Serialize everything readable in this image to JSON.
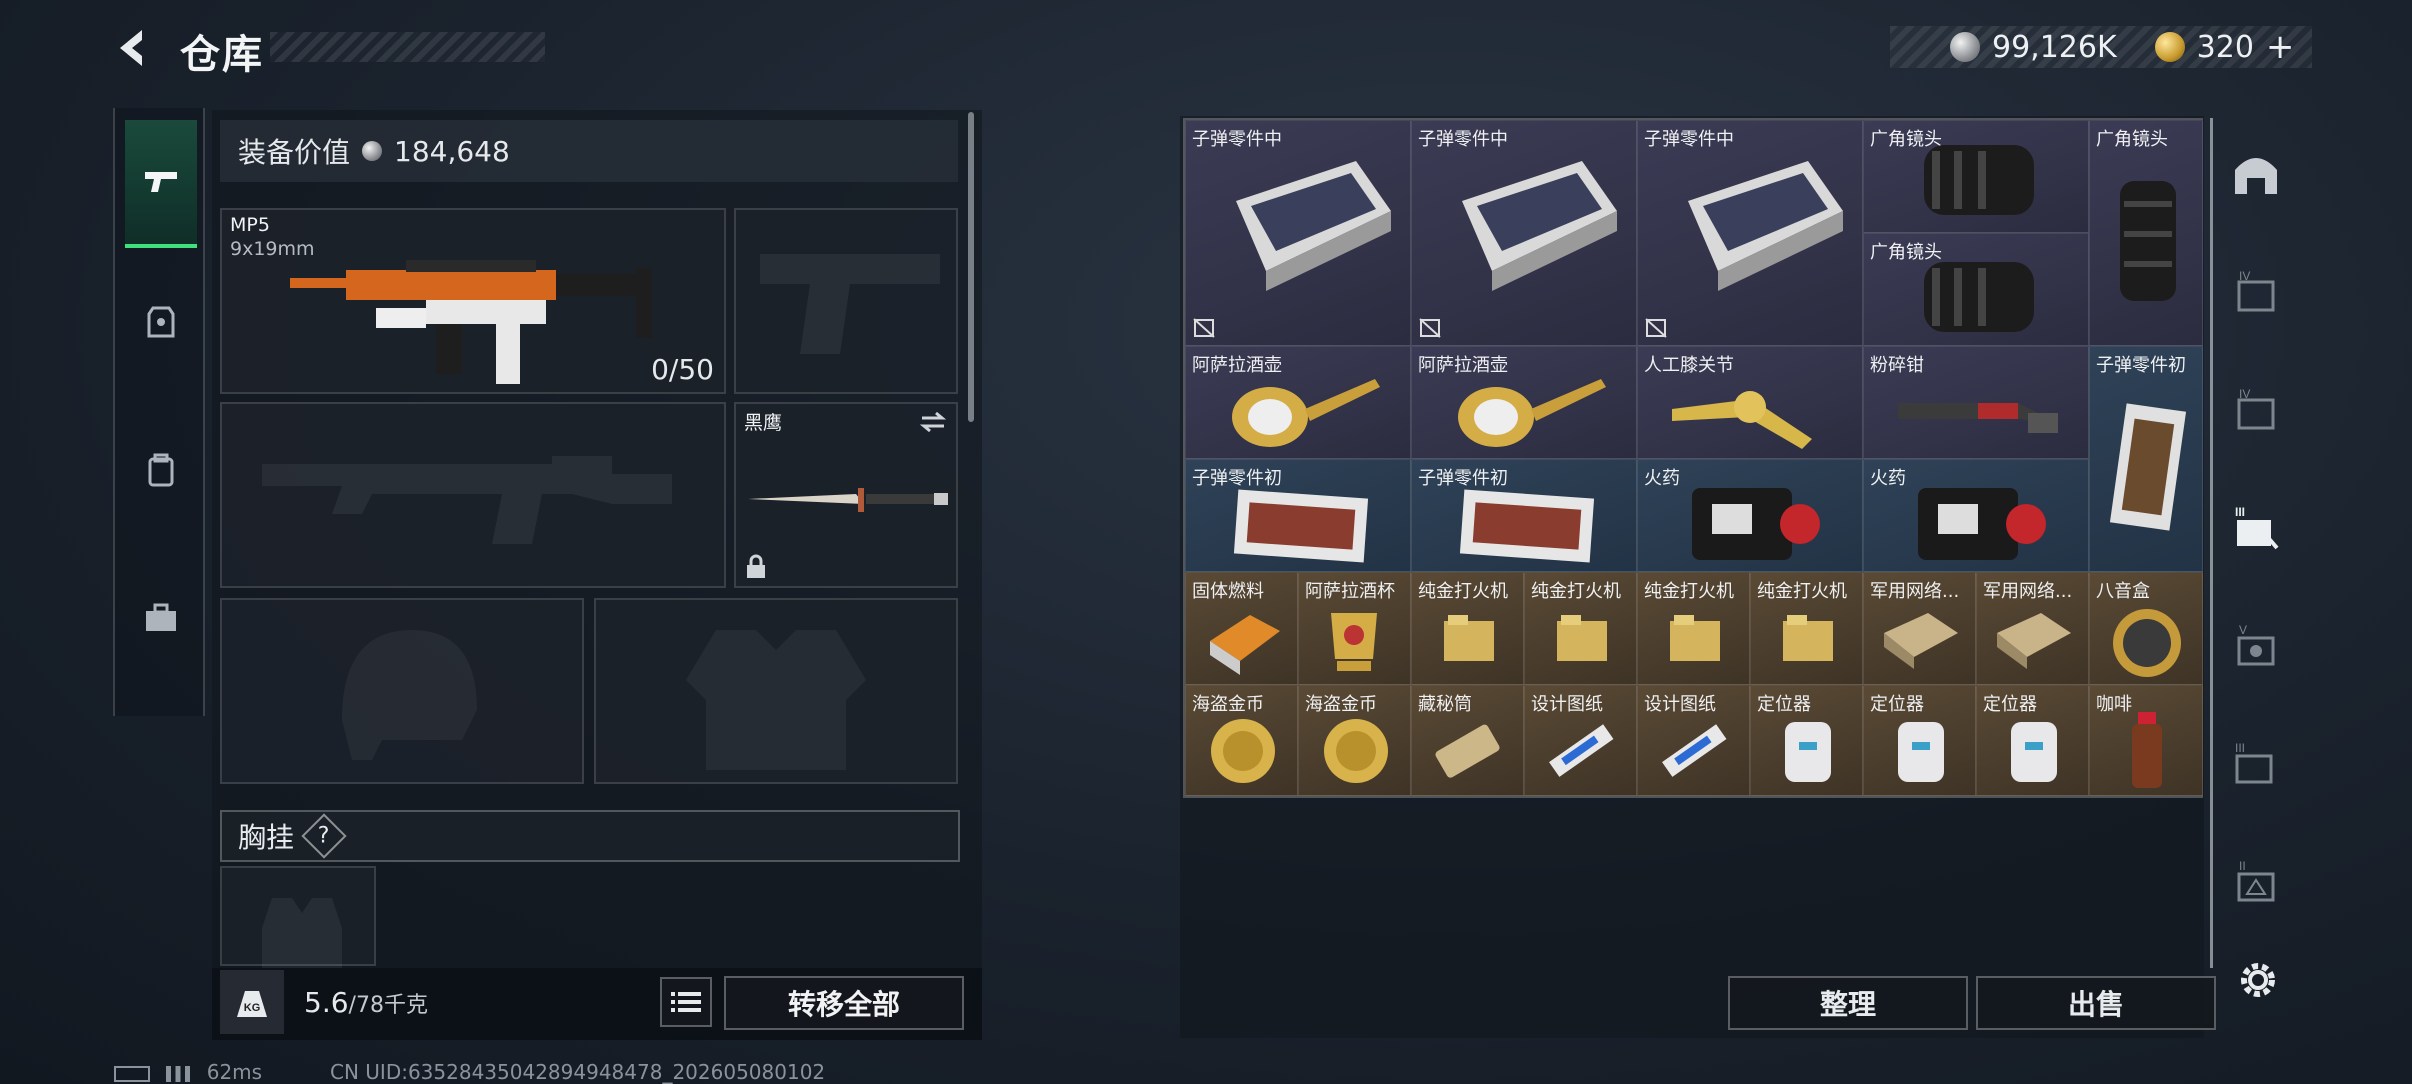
{
  "header": {
    "title": "仓库"
  },
  "currency": {
    "silver": "99,126K",
    "gold": "320"
  },
  "equipment": {
    "value_label": "装备价值",
    "value": "184,648",
    "primary_weapon": {
      "name": "MP5",
      "caliber": "9x19mm",
      "ammo": "0/50"
    },
    "melee": {
      "name": "黑鹰"
    },
    "chest_rig_label": "胸挂",
    "chest_rig_help": "?"
  },
  "capacity": {
    "current": "5.6",
    "max": "/78千克"
  },
  "buttons": {
    "transfer_all": "转移全部",
    "sort": "整理",
    "sell": "出售"
  },
  "inventory": [
    {
      "name": "子弹零件中"
    },
    {
      "name": "子弹零件中"
    },
    {
      "name": "子弹零件中"
    },
    {
      "name": "广角镜头"
    },
    {
      "name": "广角镜头"
    },
    {
      "name": "广角镜头"
    },
    {
      "name": "阿萨拉酒壶"
    },
    {
      "name": "阿萨拉酒壶"
    },
    {
      "name": "人工膝关节"
    },
    {
      "name": "粉碎钳"
    },
    {
      "name": "子弹零件初"
    },
    {
      "name": "子弹零件初"
    },
    {
      "name": "子弹零件初"
    },
    {
      "name": "火药"
    },
    {
      "name": "火药"
    },
    {
      "name": "固体燃料"
    },
    {
      "name": "阿萨拉酒杯"
    },
    {
      "name": "纯金打火机"
    },
    {
      "name": "纯金打火机"
    },
    {
      "name": "纯金打火机"
    },
    {
      "name": "纯金打火机"
    },
    {
      "name": "军用网络..."
    },
    {
      "name": "军用网络..."
    },
    {
      "name": "八音盒"
    },
    {
      "name": "海盗金币"
    },
    {
      "name": "海盗金币"
    },
    {
      "name": "藏秘筒"
    },
    {
      "name": "设计图纸"
    },
    {
      "name": "设计图纸"
    },
    {
      "name": "定位器"
    },
    {
      "name": "定位器"
    },
    {
      "name": "定位器"
    },
    {
      "name": "咖啡"
    }
  ],
  "status": {
    "ping": "62ms",
    "uid": "CN UID:63528435042894948478_202605080102"
  },
  "colors": {
    "active_tab": "#3ee07f",
    "purple_rarity": "#3b3b55",
    "blue_rarity": "#2f4257",
    "gold_rarity": "#5a4a35"
  }
}
